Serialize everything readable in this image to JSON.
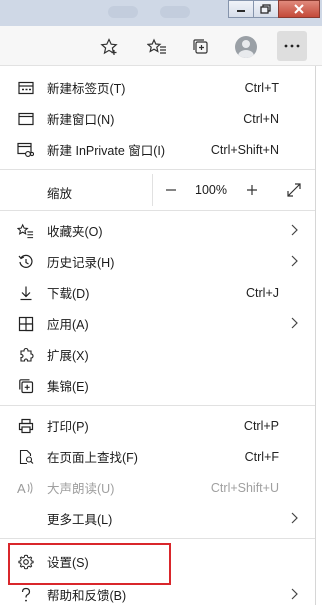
{
  "menu": {
    "new_tab": {
      "label": "新建标签页(T)",
      "shortcut": "Ctrl+T"
    },
    "new_window": {
      "label": "新建窗口(N)",
      "shortcut": "Ctrl+N"
    },
    "new_inprivate": {
      "label": "新建 InPrivate 窗口(I)",
      "shortcut": "Ctrl+Shift+N"
    },
    "zoom": {
      "label": "缩放",
      "minus": "—",
      "value": "100%",
      "plus": "+"
    },
    "favorites": {
      "label": "收藏夹(O)"
    },
    "history": {
      "label": "历史记录(H)"
    },
    "downloads": {
      "label": "下载(D)",
      "shortcut": "Ctrl+J"
    },
    "apps": {
      "label": "应用(A)"
    },
    "extensions": {
      "label": "扩展(X)"
    },
    "collections": {
      "label": "集锦(E)"
    },
    "print": {
      "label": "打印(P)",
      "shortcut": "Ctrl+P"
    },
    "find": {
      "label": "在页面上查找(F)",
      "shortcut": "Ctrl+F"
    },
    "read_aloud": {
      "label": "大声朗读(U)",
      "shortcut": "Ctrl+Shift+U"
    },
    "more_tools": {
      "label": "更多工具(L)"
    },
    "settings": {
      "label": "设置(S)"
    },
    "help": {
      "label": "帮助和反馈(B)"
    }
  },
  "colors": {
    "highlight": "#d9262b",
    "menu_bg": "#ffffff",
    "toolbar_bg": "#f7f7f7"
  },
  "icons": [
    "star-add-icon",
    "favorites-icon",
    "collections-icon",
    "profile-icon",
    "more-icon"
  ]
}
